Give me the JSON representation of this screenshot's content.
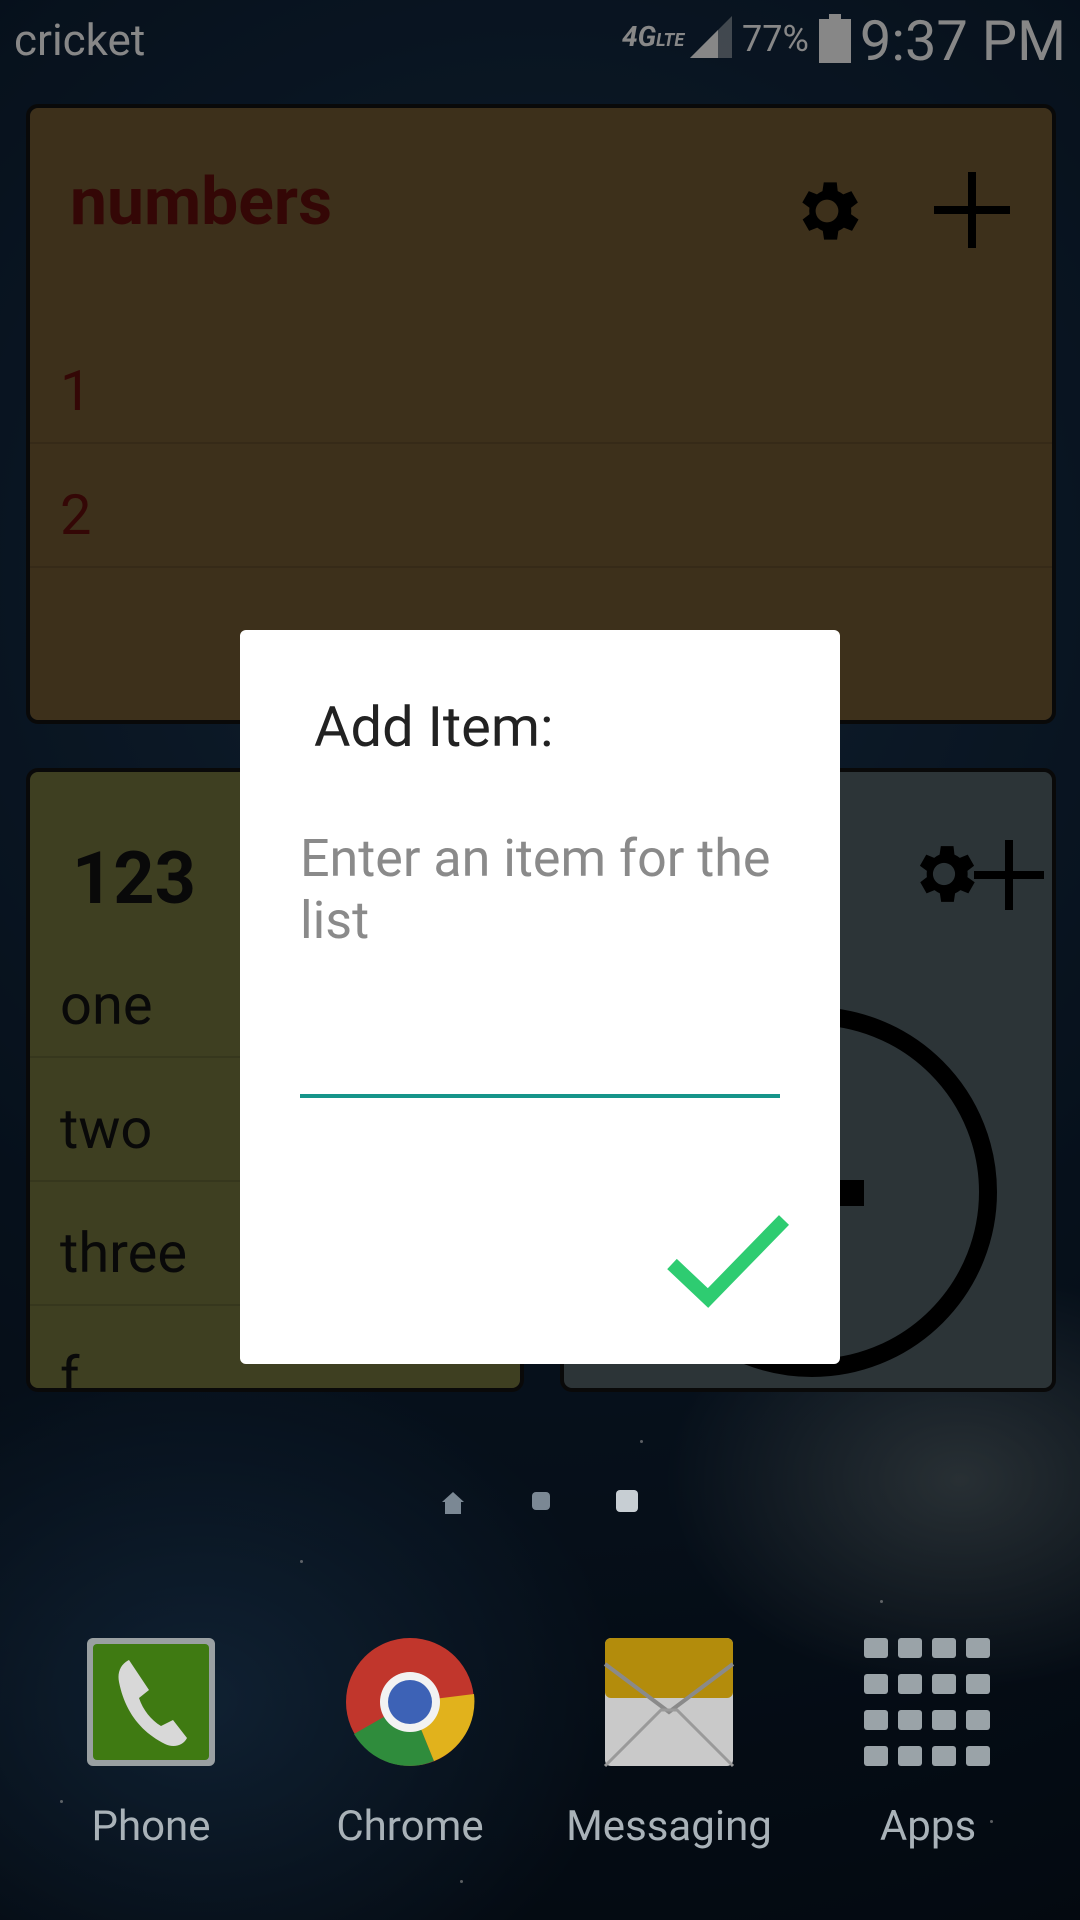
{
  "status_bar": {
    "carrier": "cricket",
    "network": "4G",
    "network_sub": "LTE",
    "battery_percent": "77%",
    "time": "9:37 PM"
  },
  "widget_numbers": {
    "title": "numbers",
    "items": [
      "1",
      "2"
    ],
    "settings_icon": "gear-icon",
    "add_icon": "plus-icon"
  },
  "widget_123": {
    "title": "123",
    "items": [
      "one",
      "two",
      "three",
      "f"
    ]
  },
  "dialog": {
    "title": "Add Item:",
    "input_placeholder": "Enter an item for the list",
    "input_value": "",
    "confirm_icon": "checkmark-icon",
    "accent_color": "#16958a",
    "confirm_color": "#2ecc71"
  },
  "home_indicators": {
    "pages": [
      "home",
      "page-2",
      "page-3"
    ],
    "active": "page-3"
  },
  "dock": {
    "apps": [
      {
        "label": "Phone",
        "icon": "phone-icon"
      },
      {
        "label": "Chrome",
        "icon": "chrome-icon"
      },
      {
        "label": "Messaging",
        "icon": "messaging-icon"
      },
      {
        "label": "Apps",
        "icon": "apps-grid-icon"
      }
    ]
  }
}
